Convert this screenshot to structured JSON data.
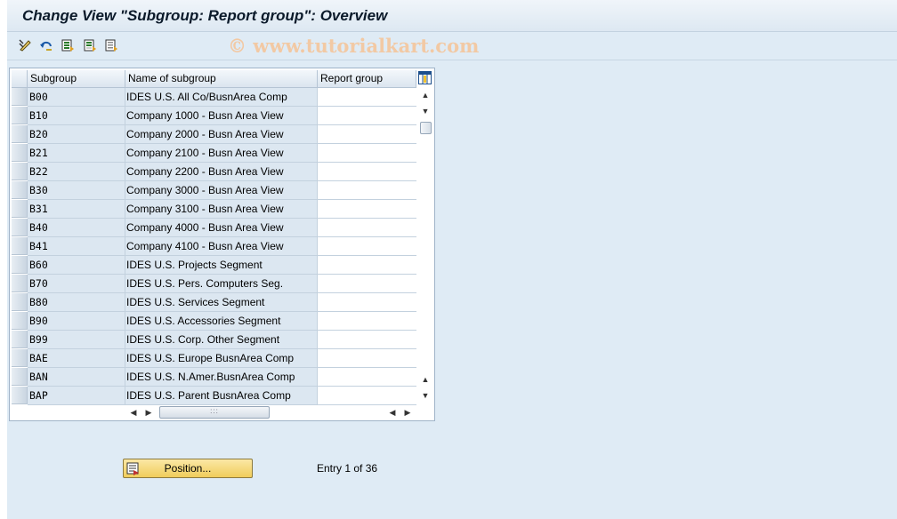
{
  "window": {
    "title": "Change View \"Subgroup: Report group\": Overview"
  },
  "watermark": "© www.tutorialkart.com",
  "toolbar": {
    "buttons": [
      {
        "name": "display-change-toggle-icon"
      },
      {
        "name": "undo-icon"
      },
      {
        "name": "select-all-icon"
      },
      {
        "name": "select-block-icon"
      },
      {
        "name": "deselect-all-icon"
      }
    ]
  },
  "table": {
    "columns": [
      "Subgroup",
      "Name of subgroup",
      "Report group"
    ],
    "rows": [
      {
        "subgroup": "B00",
        "name": "IDES U.S. All Co/BusnArea Comp",
        "report_group": ""
      },
      {
        "subgroup": "B10",
        "name": "Company 1000 - Busn Area View",
        "report_group": ""
      },
      {
        "subgroup": "B20",
        "name": "Company 2000 - Busn Area View",
        "report_group": ""
      },
      {
        "subgroup": "B21",
        "name": "Company 2100 - Busn Area View",
        "report_group": ""
      },
      {
        "subgroup": "B22",
        "name": "Company 2200 - Busn Area View",
        "report_group": ""
      },
      {
        "subgroup": "B30",
        "name": "Company 3000 - Busn Area View",
        "report_group": ""
      },
      {
        "subgroup": "B31",
        "name": "Company 3100 - Busn Area View",
        "report_group": ""
      },
      {
        "subgroup": "B40",
        "name": "Company 4000 - Busn Area View",
        "report_group": ""
      },
      {
        "subgroup": "B41",
        "name": "Company 4100 - Busn Area View",
        "report_group": ""
      },
      {
        "subgroup": "B60",
        "name": "IDES U.S. Projects Segment",
        "report_group": ""
      },
      {
        "subgroup": "B70",
        "name": "IDES U.S. Pers. Computers Seg.",
        "report_group": ""
      },
      {
        "subgroup": "B80",
        "name": "IDES U.S. Services Segment",
        "report_group": ""
      },
      {
        "subgroup": "B90",
        "name": "IDES U.S. Accessories Segment",
        "report_group": ""
      },
      {
        "subgroup": "B99",
        "name": "IDES U.S. Corp. Other Segment",
        "report_group": ""
      },
      {
        "subgroup": "BAE",
        "name": "IDES U.S. Europe BusnArea Comp",
        "report_group": ""
      },
      {
        "subgroup": "BAN",
        "name": "IDES U.S. N.Amer.BusnArea Comp",
        "report_group": ""
      },
      {
        "subgroup": "BAP",
        "name": "IDES U.S. Parent BusnArea Comp",
        "report_group": ""
      }
    ]
  },
  "position_button": {
    "label": "Position..."
  },
  "entry_info": "Entry 1 of 36"
}
